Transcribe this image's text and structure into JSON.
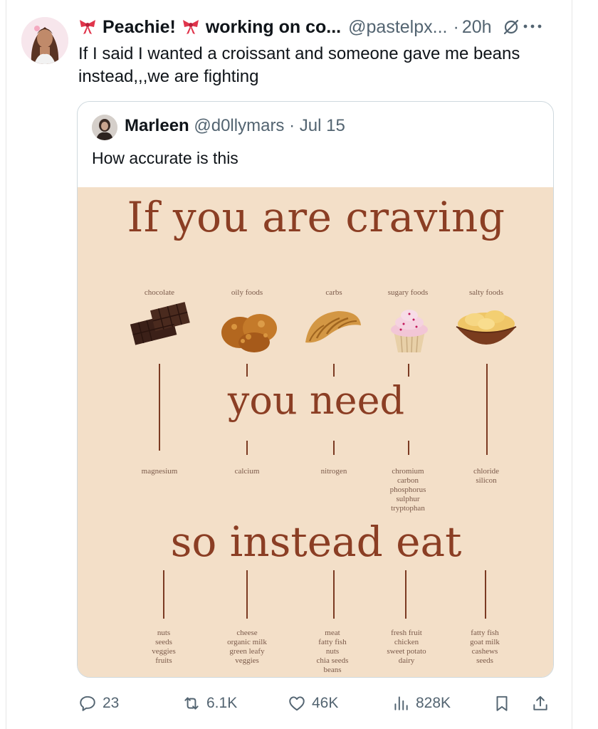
{
  "tweet": {
    "author_name": "Peachie!",
    "author_status": "working on co...",
    "handle": "@pastelpx...",
    "separator": "·",
    "time": "20h",
    "text": "If I said I wanted a croissant and someone gave me beans instead,,,we are fighting"
  },
  "quote": {
    "author_name": "Marleen",
    "handle": "@d0llymars",
    "separator": "·",
    "date": "Jul 15",
    "text": "How accurate is this"
  },
  "infographic": {
    "title": "If you are craving",
    "middle_heading": "you need",
    "bottom_heading": "so instead eat",
    "columns": [
      {
        "craving": "chocolate",
        "need": "magnesium",
        "eat": "nuts\nseeds\nveggies\nfruits",
        "food_icon": "chocolate-icon"
      },
      {
        "craving": "oily foods",
        "need": "calcium",
        "eat": "cheese\norganic milk\ngreen leafy\nveggies",
        "food_icon": "fried-chicken-icon"
      },
      {
        "craving": "carbs",
        "need": "nitrogen",
        "eat": "meat\nfatty fish\nnuts\nchia seeds\nbeans",
        "food_icon": "croissant-icon"
      },
      {
        "craving": "sugary foods",
        "need": "chromium\ncarbon\nphosphorus\nsulphur\ntryptophan",
        "eat": "fresh fruit\nchicken\nsweet potato\ndairy",
        "food_icon": "cupcake-icon"
      },
      {
        "craving": "salty foods",
        "need": "chloride\nsilicon",
        "eat": "fatty fish\ngoat milk\ncashews\nseeds",
        "food_icon": "chips-bowl-icon"
      }
    ]
  },
  "stats": {
    "replies": "23",
    "reposts": "6.1K",
    "likes": "46K",
    "views": "828K"
  },
  "colors": {
    "infographic_bg": "#f3dfc8",
    "heading": "#8b3e24",
    "text_secondary": "#536471"
  }
}
